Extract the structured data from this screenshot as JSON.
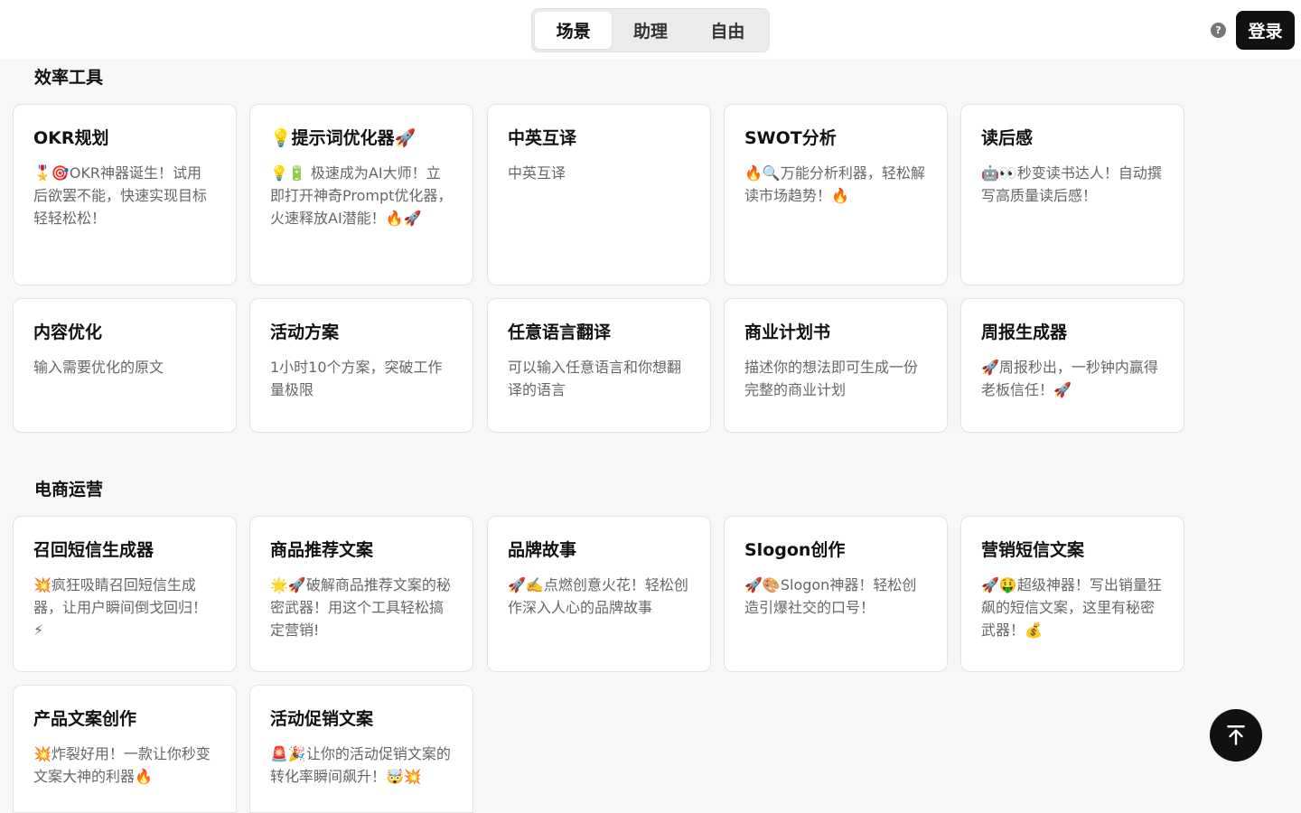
{
  "header": {
    "tabs": [
      {
        "label": "场景",
        "active": true
      },
      {
        "label": "助理",
        "active": false
      },
      {
        "label": "自由",
        "active": false
      }
    ],
    "help_icon": "?",
    "login_label": "登录"
  },
  "sections": [
    {
      "title": "效率工具",
      "cards": [
        {
          "title": "OKR规划",
          "desc": "🎖️🎯OKR神器诞生！试用后欲罢不能，快速实现目标轻轻松松！"
        },
        {
          "title": "💡提示词优化器🚀",
          "desc": "💡🔋 极速成为AI大师！立即打开神奇Prompt优化器，火速释放AI潜能！🔥🚀"
        },
        {
          "title": "中英互译",
          "desc": "中英互译"
        },
        {
          "title": "SWOT分析",
          "desc": "🔥🔍万能分析利器，轻松解读市场趋势！🔥"
        },
        {
          "title": "读后感",
          "desc": "🤖👀秒变读书达人！自动撰写高质量读后感！"
        },
        {
          "title": "内容优化",
          "desc": "输入需要优化的原文"
        },
        {
          "title": "活动方案",
          "desc": "1小时10个方案，突破工作量极限"
        },
        {
          "title": "任意语言翻译",
          "desc": "可以输入任意语言和你想翻译的语言"
        },
        {
          "title": "商业计划书",
          "desc": "描述你的想法即可生成一份完整的商业计划"
        },
        {
          "title": "周报生成器",
          "desc": "🚀周报秒出，一秒钟内赢得老板信任！🚀"
        }
      ]
    },
    {
      "title": "电商运营",
      "cards": [
        {
          "title": "召回短信生成器",
          "desc": "💥疯狂吸睛召回短信生成器，让用户瞬间倒戈回归！⚡"
        },
        {
          "title": "商品推荐文案",
          "desc": "🌟🚀破解商品推荐文案的秘密武器！用这个工具轻松搞定营销!"
        },
        {
          "title": "品牌故事",
          "desc": "🚀✍️点燃创意火花！轻松创作深入人心的品牌故事"
        },
        {
          "title": "Slogon创作",
          "desc": "🚀🎨Slogon神器！轻松创造引爆社交的口号！"
        },
        {
          "title": "营销短信文案",
          "desc": "🚀🤑超级神器！写出销量狂飙的短信文案，这里有秘密武器！💰"
        },
        {
          "title": "产品文案创作",
          "desc": "💥炸裂好用！一款让你秒变文案大神的利器🔥"
        },
        {
          "title": "活动促销文案",
          "desc": "🚨🎉让你的活动促销文案的转化率瞬间飙升！🤯💥"
        }
      ]
    }
  ],
  "back_to_top_icon": "arrow-up-to-line-icon"
}
